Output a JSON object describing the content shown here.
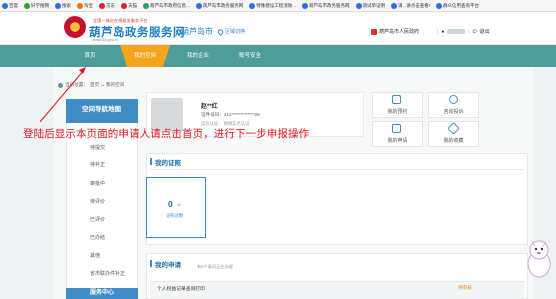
{
  "bookmarks": [
    {
      "label": "百度",
      "color": "#2f6fd6"
    },
    {
      "label": "好学搜网",
      "color": "#3a9b3a"
    },
    {
      "label": "搜索",
      "color": "#2f6fd6"
    },
    {
      "label": "淘宝",
      "color": "#f0721a"
    },
    {
      "label": "京东",
      "color": "#d0222a"
    },
    {
      "label": "天猫",
      "color": "#d0222a"
    },
    {
      "label": "葫芦岛市政府信息...",
      "color": "#2f9f5f"
    },
    {
      "label": "葫芦岛市政务服务网",
      "color": "#2f6fd6"
    },
    {
      "label": "特殊建设工程消防...",
      "color": "#2f6fd6"
    },
    {
      "label": "葫芦岛市政务服务网",
      "color": "#2f6fd6"
    },
    {
      "label": "测试单证明",
      "color": "#2f6fd6"
    },
    {
      "label": "请...请点击查看!",
      "color": "#2f6fd6"
    },
    {
      "label": "群众信用查询平台",
      "color": "#2f6fd6"
    }
  ],
  "header": {
    "site_small": "全国一体化在线政务服务平台",
    "site_title": "葫芦岛政务服务网",
    "site_url": "zwfw.hld.gov.cn",
    "city": "葫芦岛市",
    "switch_label": "区域切换",
    "gov_link": "葫芦岛市人民政府",
    "logout": "退出"
  },
  "nav": [
    {
      "label": "首页",
      "active": false
    },
    {
      "label": "我的空间",
      "active": true
    },
    {
      "label": "我的企业",
      "active": false
    },
    {
      "label": "账号安全",
      "active": false
    }
  ],
  "breadcrumb": {
    "prefix": "当前位置：",
    "home": "首页",
    "sep": ">",
    "current": "我的空间"
  },
  "sidebar": {
    "title": "空间导航地图",
    "items": [
      "待提交",
      "待补正",
      "审批中",
      "待评价",
      "已评价",
      "已办结",
      "其他",
      "省市联办件补正"
    ],
    "footer": "服务中心"
  },
  "profile": {
    "name": "赵**红",
    "id_label": "证件号码：",
    "id_value": "211*************28",
    "status": "实名认证：  网络实名认证"
  },
  "quick_links": [
    {
      "label": "我的预约",
      "icon": "calendar-icon"
    },
    {
      "label": "咨询投诉",
      "icon": "chat-icon"
    },
    {
      "label": "我的申请",
      "icon": "document-icon"
    },
    {
      "label": "我的收藏",
      "icon": "star-icon"
    }
  ],
  "certificates": {
    "title": "我的证照",
    "count": "0",
    "unit": "个",
    "label": "证照总数"
  },
  "applications": {
    "title": "我的申请",
    "subtitle": "有6个事项正在办理",
    "row_title": "个人权益记录查询打印",
    "row_sub": "",
    "row_status": "待审核"
  },
  "annotation": "登陆后显示本页面的申请人请点击首页，进行下一步申报操作",
  "colors": {
    "nav": "#4e9d9a",
    "active_tab": "#f3a51b",
    "accent": "#3f8cc7",
    "annotation": "#e0141e"
  }
}
